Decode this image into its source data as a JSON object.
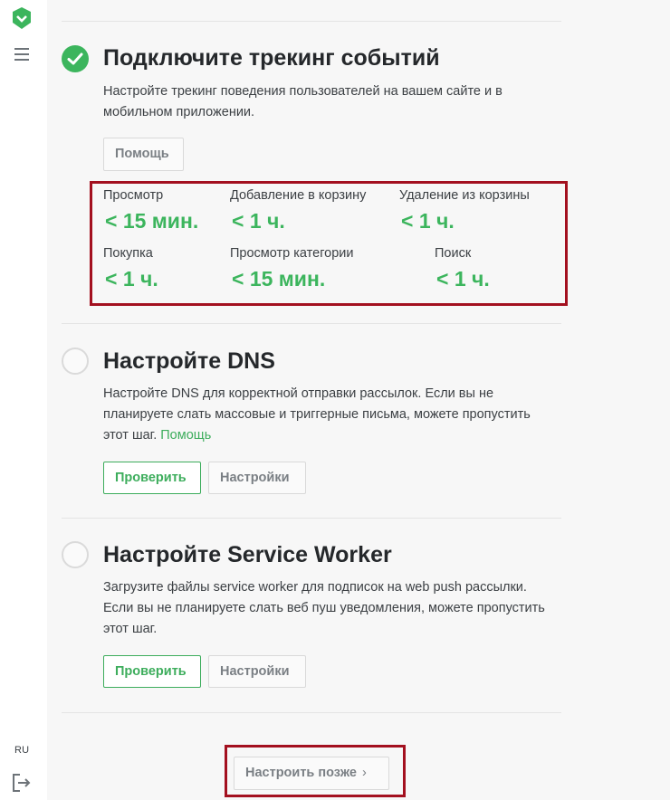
{
  "sidebar": {
    "language": "RU"
  },
  "steps": [
    {
      "title": "Подключите трекинг событий",
      "description": "Настройте трекинг поведения пользователей на вашем сайте и в мобильном приложении.",
      "status": "done",
      "help_button": "Помощь",
      "metrics": [
        {
          "label": "Просмотр",
          "value": "< 15 мин."
        },
        {
          "label": "Добавление в корзину",
          "value": "< 1 ч."
        },
        {
          "label": "Удаление из корзины",
          "value": "< 1 ч."
        },
        {
          "label": "Покупка",
          "value": "< 1 ч."
        },
        {
          "label": "Просмотр категории",
          "value": "< 15 мин."
        },
        {
          "label": "Поиск",
          "value": "< 1 ч."
        }
      ]
    },
    {
      "title": "Настройте DNS",
      "description": "Настройте DNS для корректной отправки рассылок. Если вы не планируете слать массовые и триггерные письма, можете пропустить этот шаг.",
      "help_link": "Помощь",
      "status": "todo",
      "verify_button": "Проверить",
      "settings_button": "Настройки"
    },
    {
      "title": "Настройте Service Worker",
      "description": "Загрузите файлы service worker для подписок на web push рассылки. Если вы не планируете слать веб пуш уведомления, можете пропустить этот шаг.",
      "status": "todo",
      "verify_button": "Проверить",
      "settings_button": "Настройки"
    }
  ],
  "footer": {
    "later_button": "Настроить позже"
  },
  "colors": {
    "accent_green": "#3cb55d",
    "highlight_red": "#a3101f"
  }
}
